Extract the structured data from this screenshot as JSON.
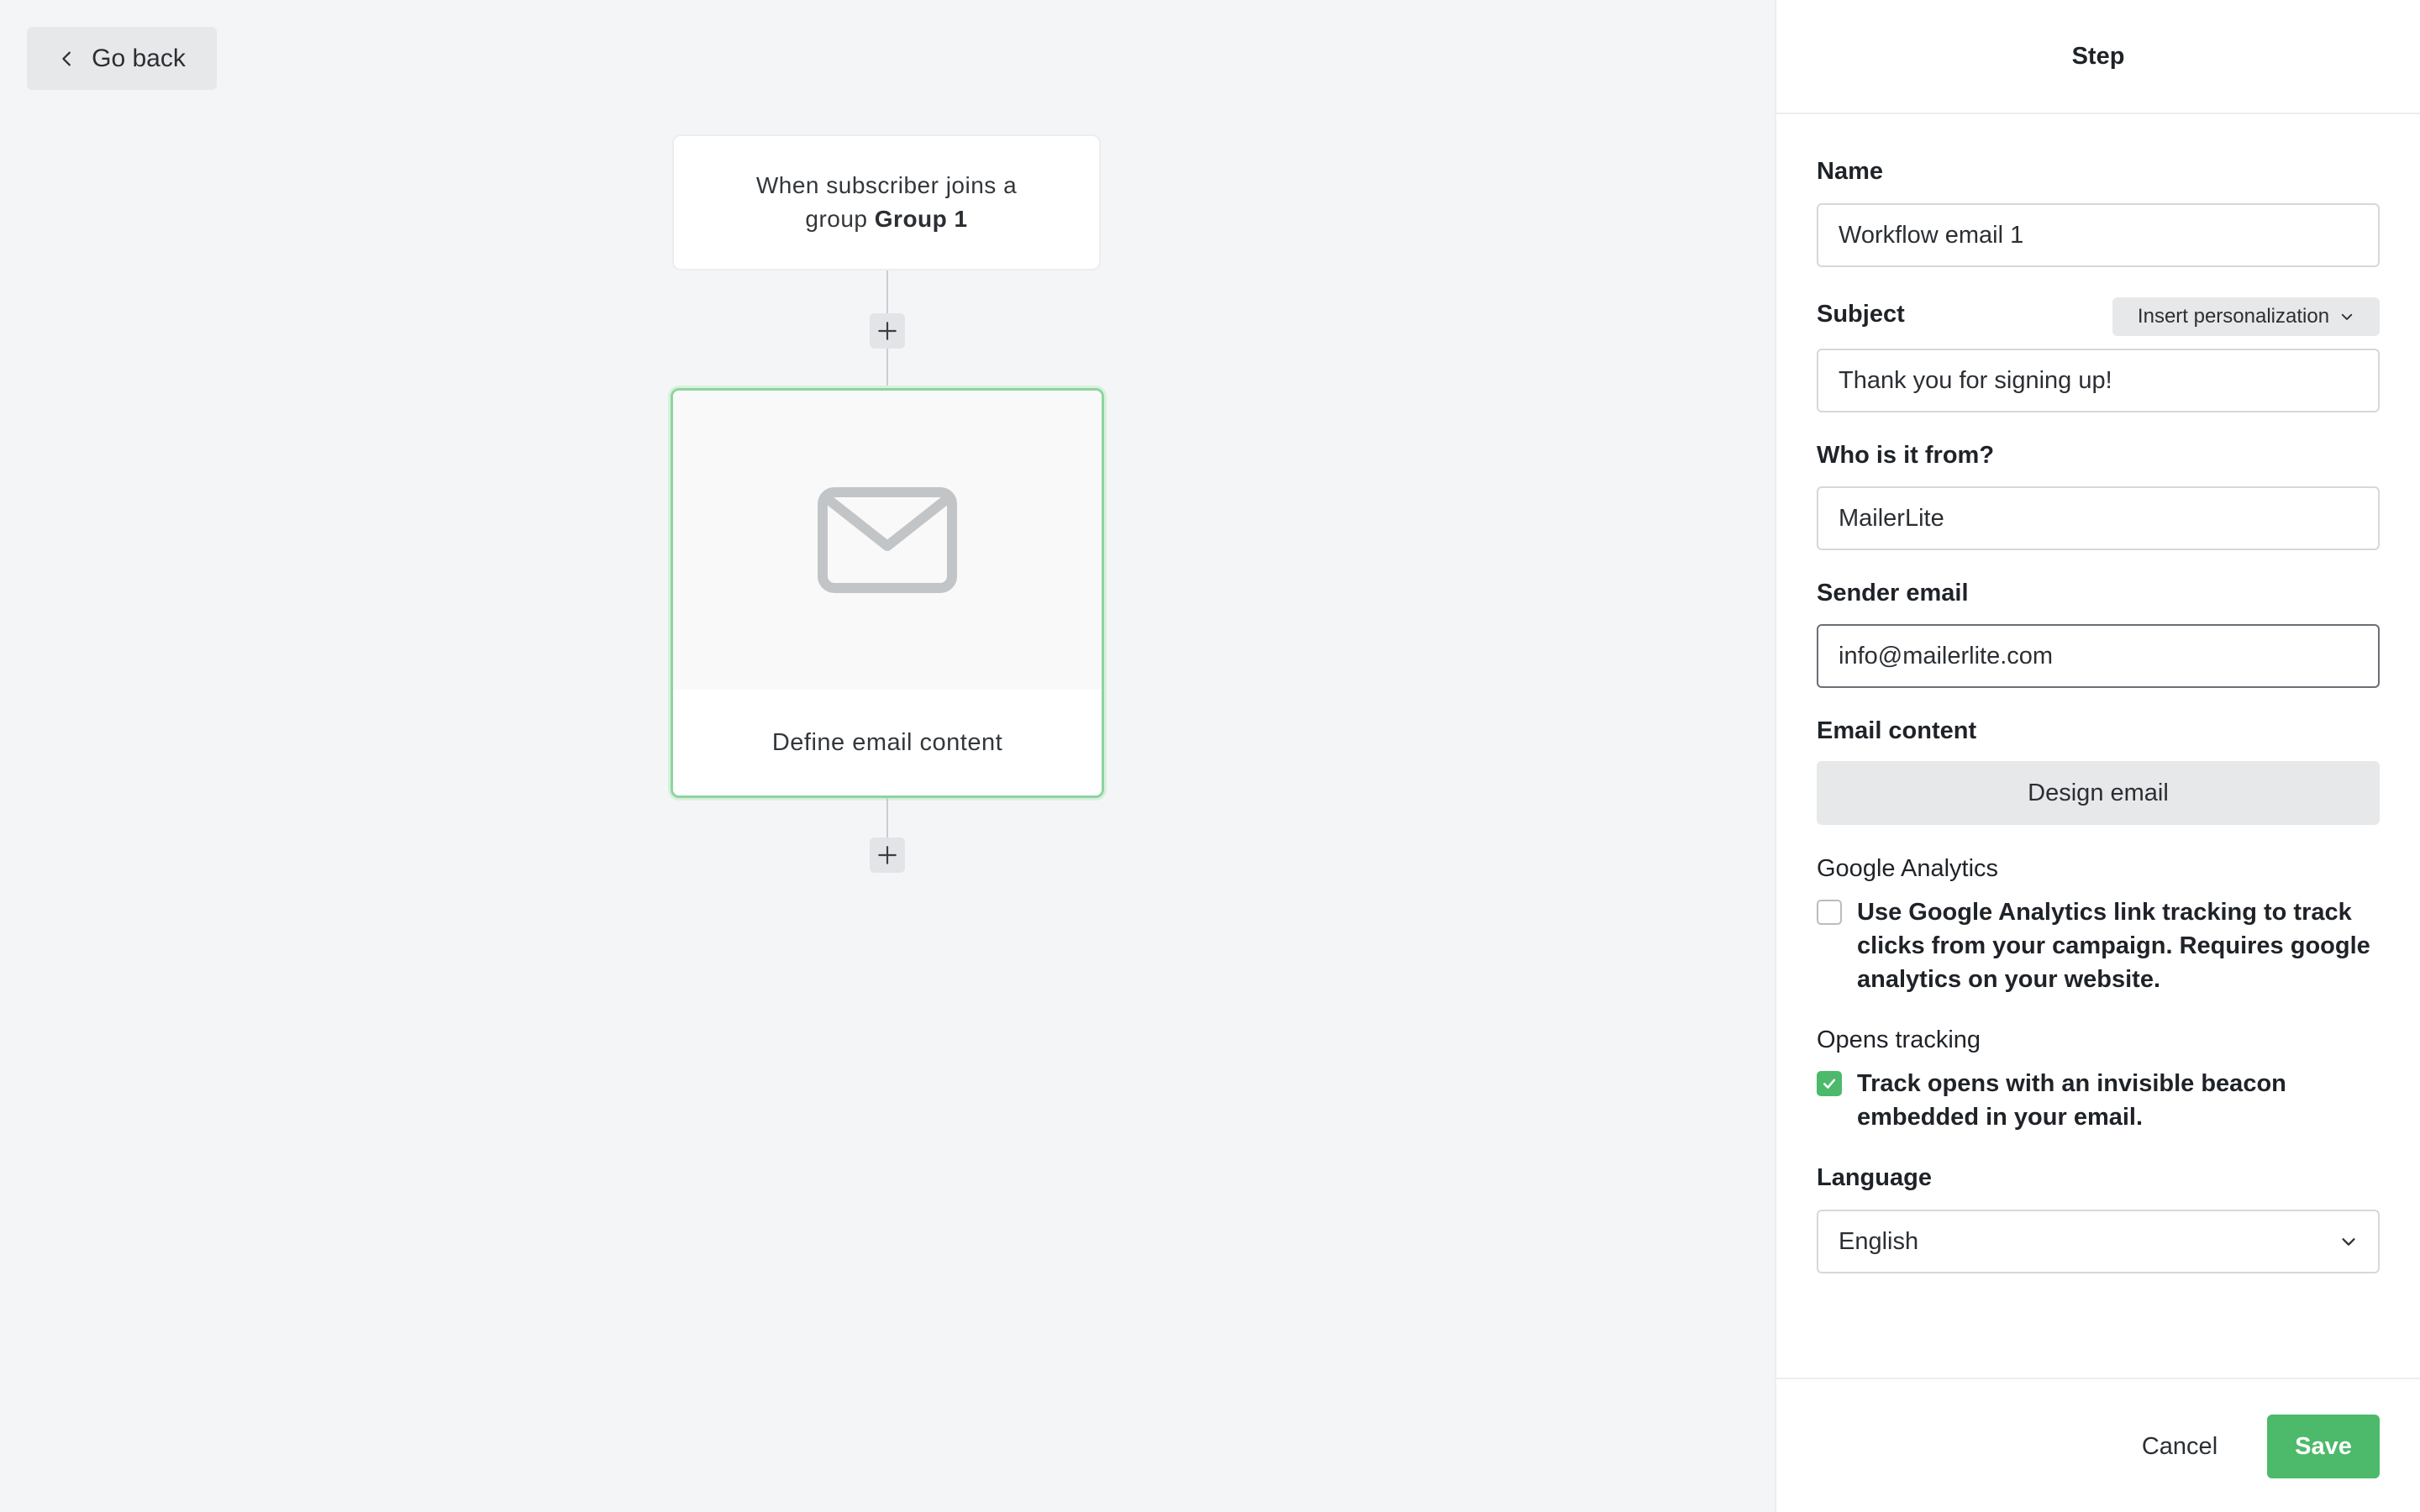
{
  "canvas": {
    "go_back_label": "Go back",
    "trigger": {
      "text_prefix": "When subscriber joins a group",
      "group_name": "Group 1"
    },
    "email_step": {
      "label": "Define email content"
    }
  },
  "panel": {
    "title": "Step",
    "name": {
      "label": "Name",
      "value": "Workflow email 1"
    },
    "subject": {
      "label": "Subject",
      "value": "Thank you for signing up!",
      "personalization_label": "Insert personalization"
    },
    "from": {
      "label": "Who is it from?",
      "value": "MailerLite"
    },
    "sender_email": {
      "label": "Sender email",
      "value": "info@mailerlite.com"
    },
    "email_content": {
      "label": "Email content",
      "button_label": "Design email"
    },
    "google_analytics": {
      "label": "Google Analytics",
      "checkbox_text": "Use Google Analytics link tracking to track clicks from your campaign. Requires google analytics on your website.",
      "checked": false
    },
    "opens_tracking": {
      "label": "Opens tracking",
      "checkbox_text": "Track opens with an invisible beacon embedded in your email.",
      "checked": true
    },
    "language": {
      "label": "Language",
      "selected": "English"
    },
    "footer": {
      "cancel_label": "Cancel",
      "save_label": "Save"
    }
  },
  "colors": {
    "accent_green": "#4cba6a",
    "selected_border": "#8fd3a0",
    "canvas_bg": "#f4f5f7"
  }
}
